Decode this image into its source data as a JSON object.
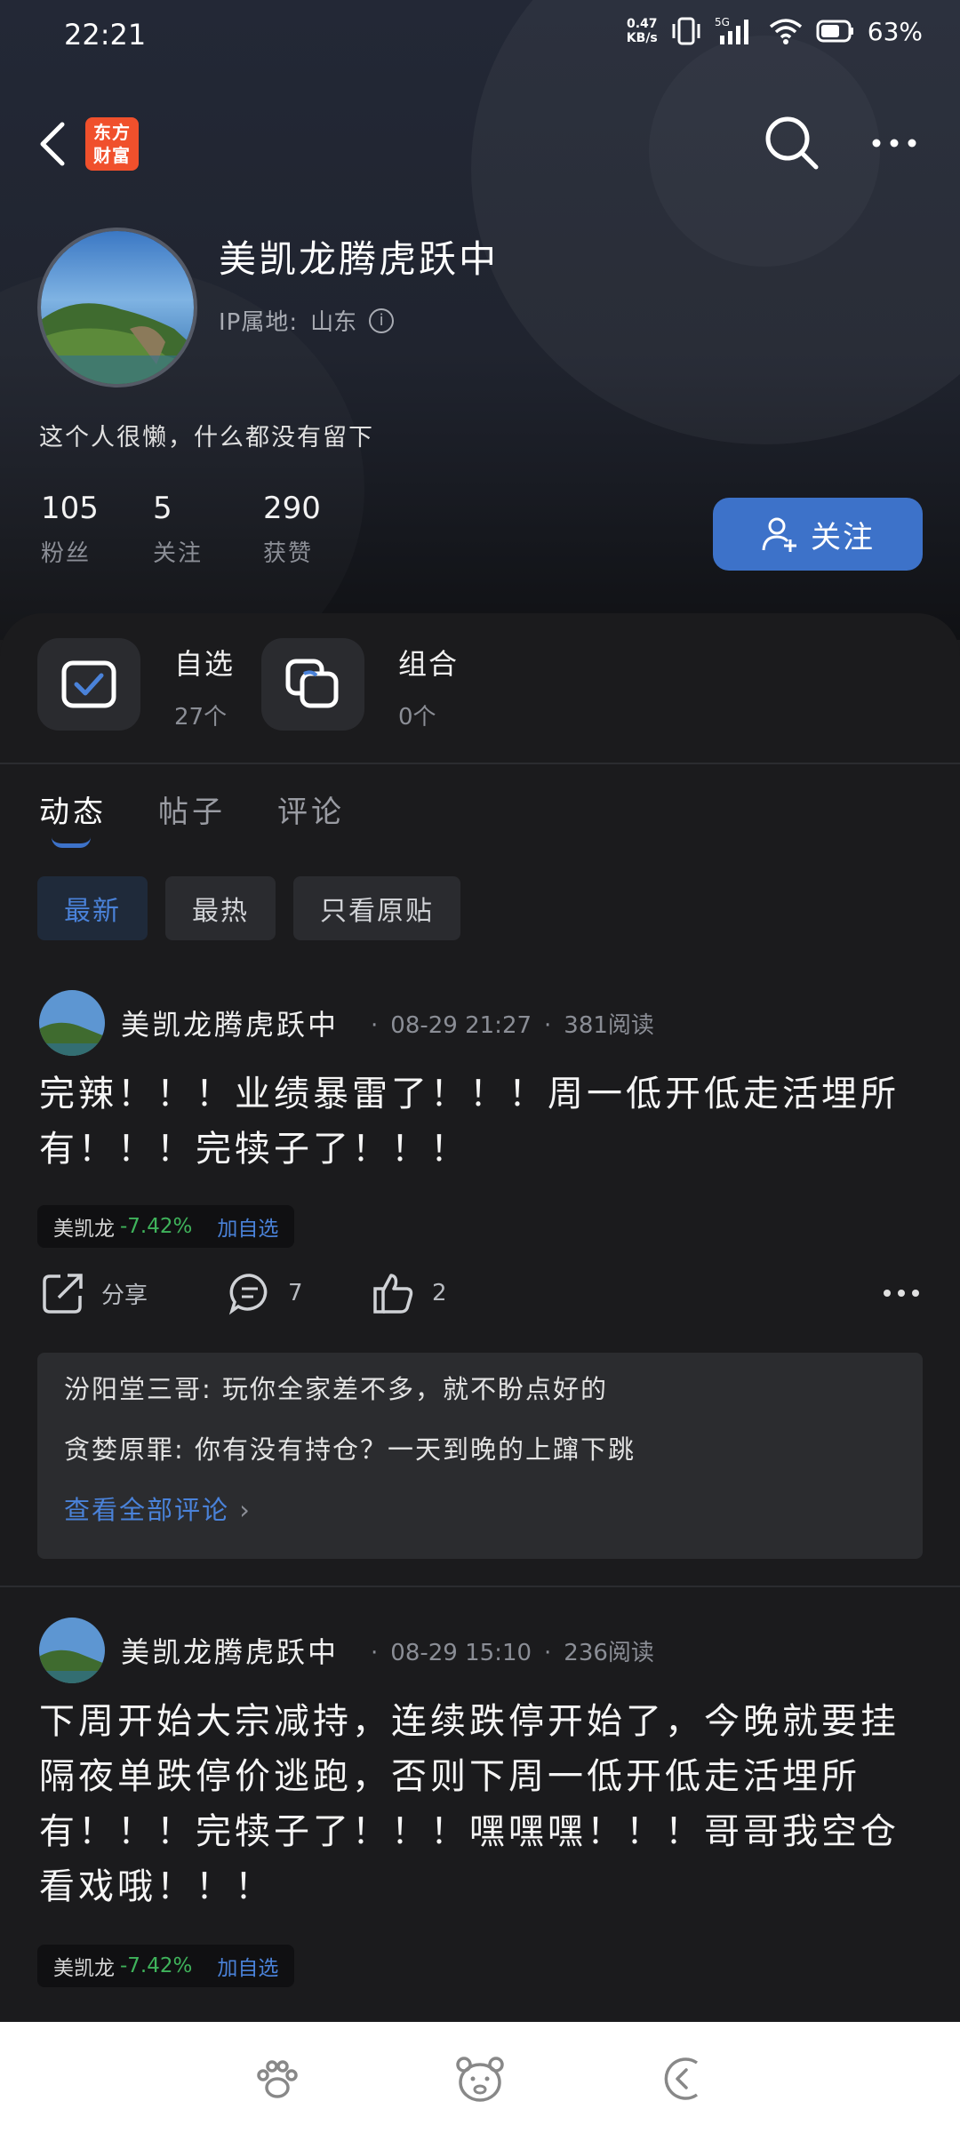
{
  "status_bar": {
    "time": "22:21",
    "net_speed_value": "0.47",
    "net_speed_unit": "KB/s",
    "network": "5G",
    "battery": "63%"
  },
  "header": {
    "app_logo_line1": "东方",
    "app_logo_line2": "财富"
  },
  "profile": {
    "username": "美凯龙腾虎跃中",
    "ip_label": "IP属地:",
    "ip_location": "山东",
    "bio": "这个人很懒，什么都没有留下",
    "stats": [
      {
        "value": "105",
        "label": "粉丝"
      },
      {
        "value": "5",
        "label": "关注"
      },
      {
        "value": "290",
        "label": "获赞"
      }
    ],
    "follow_label": "关注"
  },
  "quick_tiles": [
    {
      "title": "自选",
      "count": "27个"
    },
    {
      "title": "组合",
      "count": "0个"
    }
  ],
  "tabs": [
    {
      "label": "动态",
      "active": true
    },
    {
      "label": "帖子",
      "active": false
    },
    {
      "label": "评论",
      "active": false
    }
  ],
  "filters": [
    {
      "label": "最新",
      "active": true
    },
    {
      "label": "最热",
      "active": false
    },
    {
      "label": "只看原贴",
      "active": false
    }
  ],
  "posts": [
    {
      "author": "美凯龙腾虎跃中",
      "time": "08-29 21:27",
      "reads": "381阅读",
      "text": "完辣！！！业绩暴雷了！！！周一低开低走活埋所有！！！完犊子了！！！",
      "stock_name": "美凯龙",
      "stock_change": "-7.42%",
      "add_watch": "加自选",
      "share_label": "分享",
      "comment_count": "7",
      "like_count": "2",
      "comments": [
        {
          "user": "汾阳堂三哥:",
          "text": "玩你全家差不多，就不盼点好的"
        },
        {
          "user": "贪婪原罪:",
          "text": "你有没有持仓？一天到晚的上蹿下跳"
        }
      ],
      "view_all": "查看全部评论"
    },
    {
      "author": "美凯龙腾虎跃中",
      "time": "08-29 15:10",
      "reads": "236阅读",
      "text": "下周开始大宗减持，连续跌停开始了，今晚就要挂隔夜单跌停价逃跑，否则下周一低开低走活埋所有！！！完犊子了！！！嘿嘿嘿！！！哥哥我空仓看戏哦！！！",
      "stock_name": "美凯龙",
      "stock_change": "-7.42%",
      "add_watch": "加自选"
    }
  ],
  "colors": {
    "accent": "#3d72c9",
    "link": "#4a82d9",
    "down": "#3fb35b",
    "logo": "#f0502c"
  }
}
